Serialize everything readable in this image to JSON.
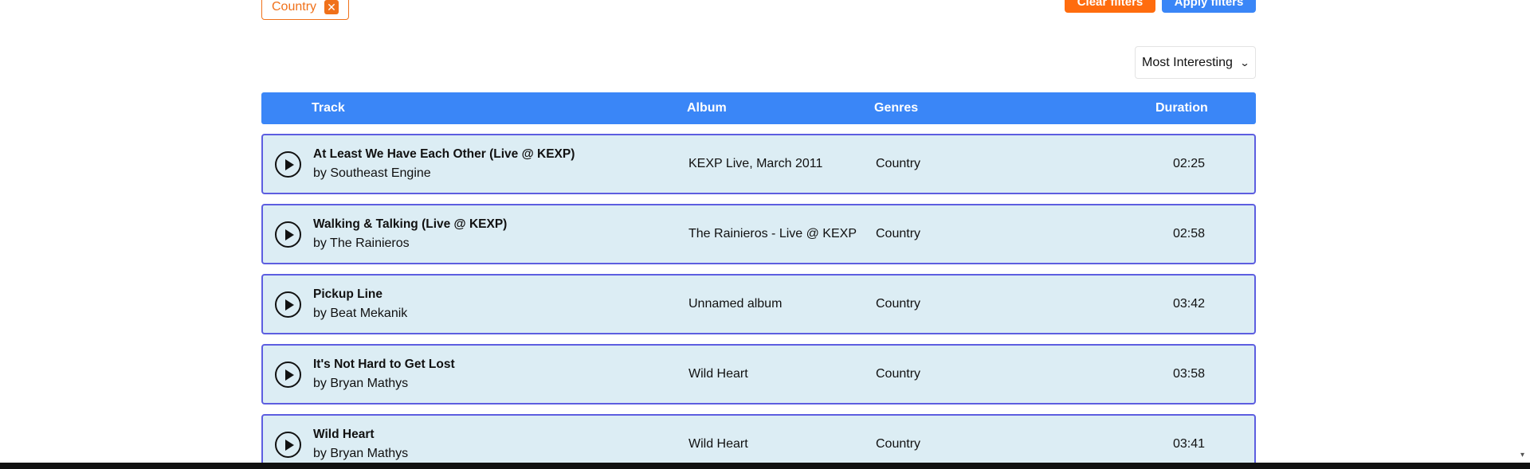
{
  "filters": {
    "chip_label": "Country",
    "chip_remove": "✕",
    "clear_label": "Clear filters",
    "apply_label": "Apply filters"
  },
  "sort": {
    "selected": "Most Interesting",
    "chevron": "⌄"
  },
  "table": {
    "headers": {
      "track": "Track",
      "album": "Album",
      "genres": "Genres",
      "duration": "Duration"
    },
    "rows": [
      {
        "title": "At Least We Have Each Other (Live @ KEXP)",
        "artist": "by Southeast Engine",
        "album": "KEXP Live, March 2011",
        "genre": "Country",
        "duration": "02:25"
      },
      {
        "title": "Walking & Talking (Live @ KEXP)",
        "artist": "by The Rainieros",
        "album": "The Rainieros - Live @ KEXP",
        "genre": "Country",
        "duration": "02:58"
      },
      {
        "title": "Pickup Line",
        "artist": "by Beat Mekanik",
        "album": "Unnamed album",
        "genre": "Country",
        "duration": "03:42"
      },
      {
        "title": "It's Not Hard to Get Lost",
        "artist": "by Bryan Mathys",
        "album": "Wild Heart",
        "genre": "Country",
        "duration": "03:58"
      },
      {
        "title": "Wild Heart",
        "artist": "by Bryan Mathys",
        "album": "Wild Heart",
        "genre": "Country",
        "duration": "03:41"
      }
    ]
  },
  "colors": {
    "accent_orange": "#ff6c0e",
    "accent_blue": "#3a86f7",
    "row_bg": "#dcedf4",
    "row_border": "#5d5ee0"
  }
}
